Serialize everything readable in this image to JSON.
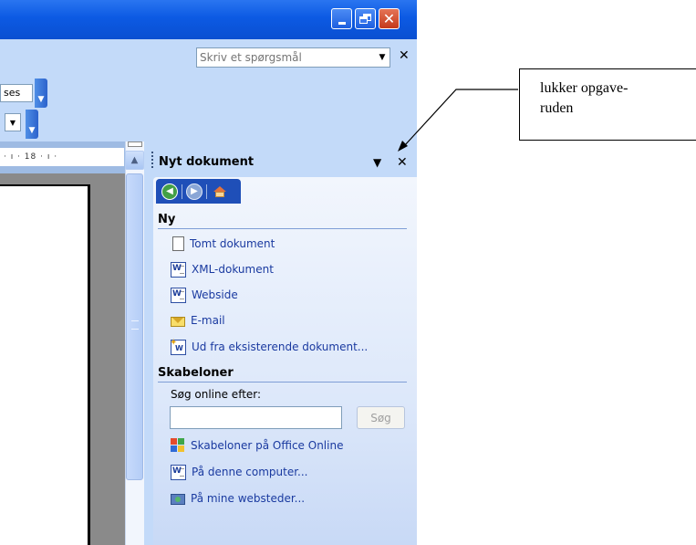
{
  "help": {
    "placeholder": "Skriv et spørgsmål"
  },
  "toolbar": {
    "style_fragment": "ses"
  },
  "ruler": {
    "text": "· ı · 18 · ı ·"
  },
  "task_pane": {
    "title": "Nyt dokument",
    "sections": {
      "new": {
        "title": "Ny",
        "items": [
          {
            "label": "Tomt dokument",
            "icon": "blank-document-icon"
          },
          {
            "label": "XML-dokument",
            "icon": "xml-document-icon"
          },
          {
            "label": "Webside",
            "icon": "web-page-icon"
          },
          {
            "label": "E-mail",
            "icon": "email-icon"
          },
          {
            "label": "Ud fra eksisterende dokument...",
            "icon": "existing-document-icon"
          }
        ]
      },
      "templates": {
        "title": "Skabeloner",
        "search_label": "Søg online efter:",
        "search_value": "",
        "search_button": "Søg",
        "items": [
          {
            "label": "Skabeloner på Office Online",
            "icon": "office-online-icon"
          },
          {
            "label": "På denne computer...",
            "icon": "computer-templates-icon"
          },
          {
            "label": "På mine websteder...",
            "icon": "websites-icon"
          }
        ]
      }
    }
  },
  "callout": {
    "text_line1": "lukker opgave-",
    "text_line2": "ruden"
  }
}
